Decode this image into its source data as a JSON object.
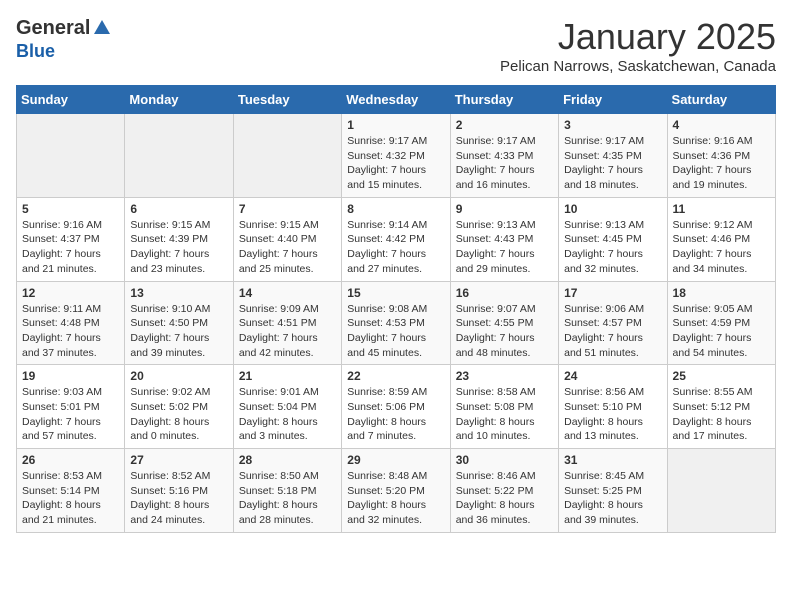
{
  "header": {
    "logo_line1": "General",
    "logo_line2": "Blue",
    "title": "January 2025",
    "subtitle": "Pelican Narrows, Saskatchewan, Canada"
  },
  "weekdays": [
    "Sunday",
    "Monday",
    "Tuesday",
    "Wednesday",
    "Thursday",
    "Friday",
    "Saturday"
  ],
  "weeks": [
    [
      {
        "day": "",
        "info": ""
      },
      {
        "day": "",
        "info": ""
      },
      {
        "day": "",
        "info": ""
      },
      {
        "day": "1",
        "info": "Sunrise: 9:17 AM\nSunset: 4:32 PM\nDaylight: 7 hours\nand 15 minutes."
      },
      {
        "day": "2",
        "info": "Sunrise: 9:17 AM\nSunset: 4:33 PM\nDaylight: 7 hours\nand 16 minutes."
      },
      {
        "day": "3",
        "info": "Sunrise: 9:17 AM\nSunset: 4:35 PM\nDaylight: 7 hours\nand 18 minutes."
      },
      {
        "day": "4",
        "info": "Sunrise: 9:16 AM\nSunset: 4:36 PM\nDaylight: 7 hours\nand 19 minutes."
      }
    ],
    [
      {
        "day": "5",
        "info": "Sunrise: 9:16 AM\nSunset: 4:37 PM\nDaylight: 7 hours\nand 21 minutes."
      },
      {
        "day": "6",
        "info": "Sunrise: 9:15 AM\nSunset: 4:39 PM\nDaylight: 7 hours\nand 23 minutes."
      },
      {
        "day": "7",
        "info": "Sunrise: 9:15 AM\nSunset: 4:40 PM\nDaylight: 7 hours\nand 25 minutes."
      },
      {
        "day": "8",
        "info": "Sunrise: 9:14 AM\nSunset: 4:42 PM\nDaylight: 7 hours\nand 27 minutes."
      },
      {
        "day": "9",
        "info": "Sunrise: 9:13 AM\nSunset: 4:43 PM\nDaylight: 7 hours\nand 29 minutes."
      },
      {
        "day": "10",
        "info": "Sunrise: 9:13 AM\nSunset: 4:45 PM\nDaylight: 7 hours\nand 32 minutes."
      },
      {
        "day": "11",
        "info": "Sunrise: 9:12 AM\nSunset: 4:46 PM\nDaylight: 7 hours\nand 34 minutes."
      }
    ],
    [
      {
        "day": "12",
        "info": "Sunrise: 9:11 AM\nSunset: 4:48 PM\nDaylight: 7 hours\nand 37 minutes."
      },
      {
        "day": "13",
        "info": "Sunrise: 9:10 AM\nSunset: 4:50 PM\nDaylight: 7 hours\nand 39 minutes."
      },
      {
        "day": "14",
        "info": "Sunrise: 9:09 AM\nSunset: 4:51 PM\nDaylight: 7 hours\nand 42 minutes."
      },
      {
        "day": "15",
        "info": "Sunrise: 9:08 AM\nSunset: 4:53 PM\nDaylight: 7 hours\nand 45 minutes."
      },
      {
        "day": "16",
        "info": "Sunrise: 9:07 AM\nSunset: 4:55 PM\nDaylight: 7 hours\nand 48 minutes."
      },
      {
        "day": "17",
        "info": "Sunrise: 9:06 AM\nSunset: 4:57 PM\nDaylight: 7 hours\nand 51 minutes."
      },
      {
        "day": "18",
        "info": "Sunrise: 9:05 AM\nSunset: 4:59 PM\nDaylight: 7 hours\nand 54 minutes."
      }
    ],
    [
      {
        "day": "19",
        "info": "Sunrise: 9:03 AM\nSunset: 5:01 PM\nDaylight: 7 hours\nand 57 minutes."
      },
      {
        "day": "20",
        "info": "Sunrise: 9:02 AM\nSunset: 5:02 PM\nDaylight: 8 hours\nand 0 minutes."
      },
      {
        "day": "21",
        "info": "Sunrise: 9:01 AM\nSunset: 5:04 PM\nDaylight: 8 hours\nand 3 minutes."
      },
      {
        "day": "22",
        "info": "Sunrise: 8:59 AM\nSunset: 5:06 PM\nDaylight: 8 hours\nand 7 minutes."
      },
      {
        "day": "23",
        "info": "Sunrise: 8:58 AM\nSunset: 5:08 PM\nDaylight: 8 hours\nand 10 minutes."
      },
      {
        "day": "24",
        "info": "Sunrise: 8:56 AM\nSunset: 5:10 PM\nDaylight: 8 hours\nand 13 minutes."
      },
      {
        "day": "25",
        "info": "Sunrise: 8:55 AM\nSunset: 5:12 PM\nDaylight: 8 hours\nand 17 minutes."
      }
    ],
    [
      {
        "day": "26",
        "info": "Sunrise: 8:53 AM\nSunset: 5:14 PM\nDaylight: 8 hours\nand 21 minutes."
      },
      {
        "day": "27",
        "info": "Sunrise: 8:52 AM\nSunset: 5:16 PM\nDaylight: 8 hours\nand 24 minutes."
      },
      {
        "day": "28",
        "info": "Sunrise: 8:50 AM\nSunset: 5:18 PM\nDaylight: 8 hours\nand 28 minutes."
      },
      {
        "day": "29",
        "info": "Sunrise: 8:48 AM\nSunset: 5:20 PM\nDaylight: 8 hours\nand 32 minutes."
      },
      {
        "day": "30",
        "info": "Sunrise: 8:46 AM\nSunset: 5:22 PM\nDaylight: 8 hours\nand 36 minutes."
      },
      {
        "day": "31",
        "info": "Sunrise: 8:45 AM\nSunset: 5:25 PM\nDaylight: 8 hours\nand 39 minutes."
      },
      {
        "day": "",
        "info": ""
      }
    ]
  ]
}
